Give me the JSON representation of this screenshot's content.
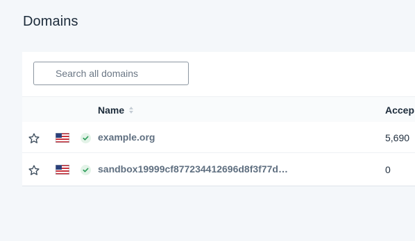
{
  "page": {
    "title": "Domains"
  },
  "search": {
    "placeholder": "Search all domains",
    "value": ""
  },
  "table": {
    "columns": {
      "name": "Name",
      "accepted": "Accep"
    },
    "rows": [
      {
        "starred": false,
        "flag": "us-flag-icon",
        "verified": true,
        "domain": "example.org",
        "accepted": "5,690"
      },
      {
        "starred": false,
        "flag": "us-flag-icon",
        "verified": true,
        "domain": "sandbox19999cf877234412696d8f3f77d…",
        "accepted": "0"
      }
    ]
  },
  "colors": {
    "background": "#f4f7fa",
    "card": "#ffffff",
    "link": "#5f6f80",
    "verified": "#2e9e5b"
  }
}
